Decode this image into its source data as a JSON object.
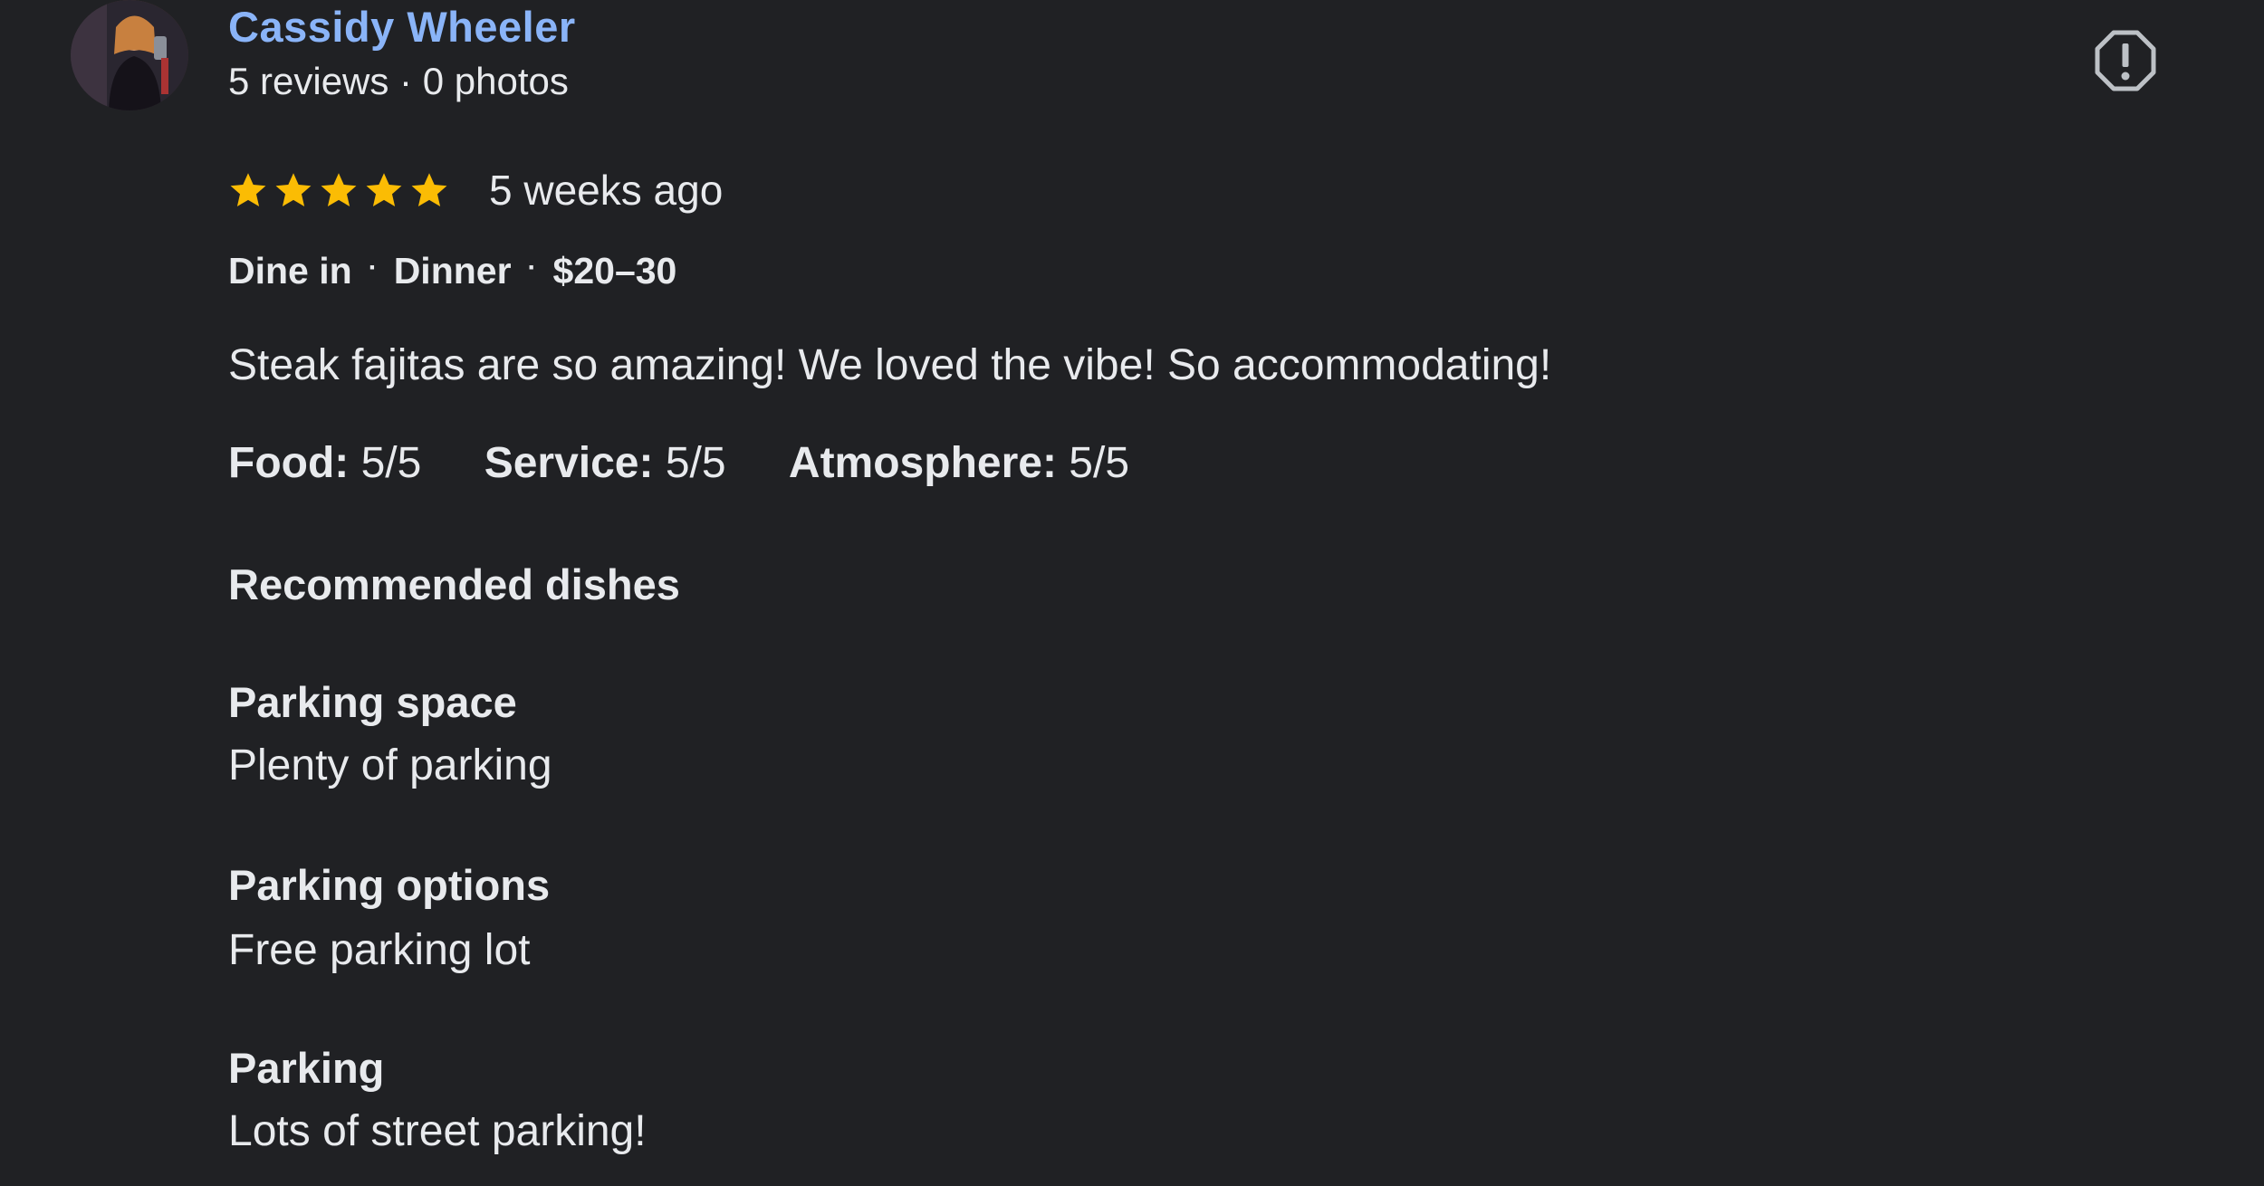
{
  "reviewer": {
    "name": "Cassidy Wheeler",
    "meta": "5 reviews · 0 photos"
  },
  "review": {
    "rating": 5,
    "rating_max": 5,
    "time_ago": "5 weeks ago",
    "context": [
      "Dine in",
      "Dinner",
      "$20–30"
    ],
    "text": "Steak fajitas are so amazing! We loved the vibe! So accommodating!",
    "scores": [
      {
        "label": "Food:",
        "value": "5/5"
      },
      {
        "label": "Service:",
        "value": "5/5"
      },
      {
        "label": "Atmosphere:",
        "value": "5/5"
      }
    ],
    "recommended_dishes_label": "Recommended dishes",
    "details": [
      {
        "label": "Parking space",
        "value": "Plenty of parking"
      },
      {
        "label": "Parking options",
        "value": "Free parking lot"
      },
      {
        "label": "Parking",
        "value": "Lots of street parking!"
      }
    ]
  },
  "colors": {
    "background": "#202124",
    "name_link": "#8ab4f8",
    "star": "#fbbc04",
    "text": "#e8eaed"
  },
  "icons": {
    "avatar": "user-avatar-photo",
    "star": "star-icon",
    "flag": "report-flag-icon"
  }
}
